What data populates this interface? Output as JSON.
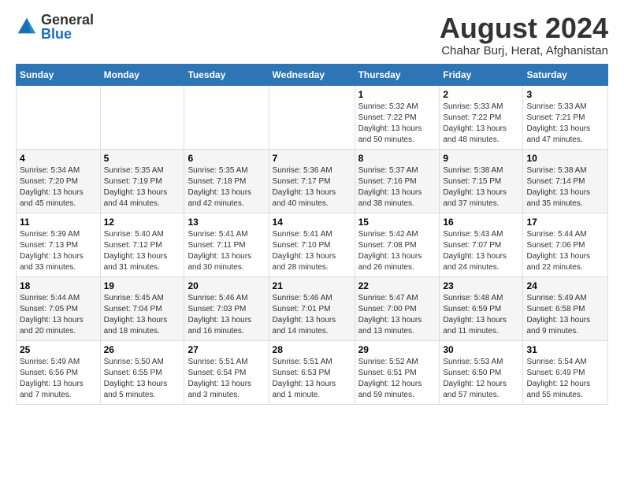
{
  "logo": {
    "general": "General",
    "blue": "Blue"
  },
  "title": "August 2024",
  "subtitle": "Chahar Burj, Herat, Afghanistan",
  "days_of_week": [
    "Sunday",
    "Monday",
    "Tuesday",
    "Wednesday",
    "Thursday",
    "Friday",
    "Saturday"
  ],
  "weeks": [
    [
      {
        "day": "",
        "info": ""
      },
      {
        "day": "",
        "info": ""
      },
      {
        "day": "",
        "info": ""
      },
      {
        "day": "",
        "info": ""
      },
      {
        "day": "1",
        "info": "Sunrise: 5:32 AM\nSunset: 7:22 PM\nDaylight: 13 hours\nand 50 minutes."
      },
      {
        "day": "2",
        "info": "Sunrise: 5:33 AM\nSunset: 7:22 PM\nDaylight: 13 hours\nand 48 minutes."
      },
      {
        "day": "3",
        "info": "Sunrise: 5:33 AM\nSunset: 7:21 PM\nDaylight: 13 hours\nand 47 minutes."
      }
    ],
    [
      {
        "day": "4",
        "info": "Sunrise: 5:34 AM\nSunset: 7:20 PM\nDaylight: 13 hours\nand 45 minutes."
      },
      {
        "day": "5",
        "info": "Sunrise: 5:35 AM\nSunset: 7:19 PM\nDaylight: 13 hours\nand 44 minutes."
      },
      {
        "day": "6",
        "info": "Sunrise: 5:35 AM\nSunset: 7:18 PM\nDaylight: 13 hours\nand 42 minutes."
      },
      {
        "day": "7",
        "info": "Sunrise: 5:36 AM\nSunset: 7:17 PM\nDaylight: 13 hours\nand 40 minutes."
      },
      {
        "day": "8",
        "info": "Sunrise: 5:37 AM\nSunset: 7:16 PM\nDaylight: 13 hours\nand 38 minutes."
      },
      {
        "day": "9",
        "info": "Sunrise: 5:38 AM\nSunset: 7:15 PM\nDaylight: 13 hours\nand 37 minutes."
      },
      {
        "day": "10",
        "info": "Sunrise: 5:38 AM\nSunset: 7:14 PM\nDaylight: 13 hours\nand 35 minutes."
      }
    ],
    [
      {
        "day": "11",
        "info": "Sunrise: 5:39 AM\nSunset: 7:13 PM\nDaylight: 13 hours\nand 33 minutes."
      },
      {
        "day": "12",
        "info": "Sunrise: 5:40 AM\nSunset: 7:12 PM\nDaylight: 13 hours\nand 31 minutes."
      },
      {
        "day": "13",
        "info": "Sunrise: 5:41 AM\nSunset: 7:11 PM\nDaylight: 13 hours\nand 30 minutes."
      },
      {
        "day": "14",
        "info": "Sunrise: 5:41 AM\nSunset: 7:10 PM\nDaylight: 13 hours\nand 28 minutes."
      },
      {
        "day": "15",
        "info": "Sunrise: 5:42 AM\nSunset: 7:08 PM\nDaylight: 13 hours\nand 26 minutes."
      },
      {
        "day": "16",
        "info": "Sunrise: 5:43 AM\nSunset: 7:07 PM\nDaylight: 13 hours\nand 24 minutes."
      },
      {
        "day": "17",
        "info": "Sunrise: 5:44 AM\nSunset: 7:06 PM\nDaylight: 13 hours\nand 22 minutes."
      }
    ],
    [
      {
        "day": "18",
        "info": "Sunrise: 5:44 AM\nSunset: 7:05 PM\nDaylight: 13 hours\nand 20 minutes."
      },
      {
        "day": "19",
        "info": "Sunrise: 5:45 AM\nSunset: 7:04 PM\nDaylight: 13 hours\nand 18 minutes."
      },
      {
        "day": "20",
        "info": "Sunrise: 5:46 AM\nSunset: 7:03 PM\nDaylight: 13 hours\nand 16 minutes."
      },
      {
        "day": "21",
        "info": "Sunrise: 5:46 AM\nSunset: 7:01 PM\nDaylight: 13 hours\nand 14 minutes."
      },
      {
        "day": "22",
        "info": "Sunrise: 5:47 AM\nSunset: 7:00 PM\nDaylight: 13 hours\nand 13 minutes."
      },
      {
        "day": "23",
        "info": "Sunrise: 5:48 AM\nSunset: 6:59 PM\nDaylight: 13 hours\nand 11 minutes."
      },
      {
        "day": "24",
        "info": "Sunrise: 5:49 AM\nSunset: 6:58 PM\nDaylight: 13 hours\nand 9 minutes."
      }
    ],
    [
      {
        "day": "25",
        "info": "Sunrise: 5:49 AM\nSunset: 6:56 PM\nDaylight: 13 hours\nand 7 minutes."
      },
      {
        "day": "26",
        "info": "Sunrise: 5:50 AM\nSunset: 6:55 PM\nDaylight: 13 hours\nand 5 minutes."
      },
      {
        "day": "27",
        "info": "Sunrise: 5:51 AM\nSunset: 6:54 PM\nDaylight: 13 hours\nand 3 minutes."
      },
      {
        "day": "28",
        "info": "Sunrise: 5:51 AM\nSunset: 6:53 PM\nDaylight: 13 hours\nand 1 minute."
      },
      {
        "day": "29",
        "info": "Sunrise: 5:52 AM\nSunset: 6:51 PM\nDaylight: 12 hours\nand 59 minutes."
      },
      {
        "day": "30",
        "info": "Sunrise: 5:53 AM\nSunset: 6:50 PM\nDaylight: 12 hours\nand 57 minutes."
      },
      {
        "day": "31",
        "info": "Sunrise: 5:54 AM\nSunset: 6:49 PM\nDaylight: 12 hours\nand 55 minutes."
      }
    ]
  ]
}
